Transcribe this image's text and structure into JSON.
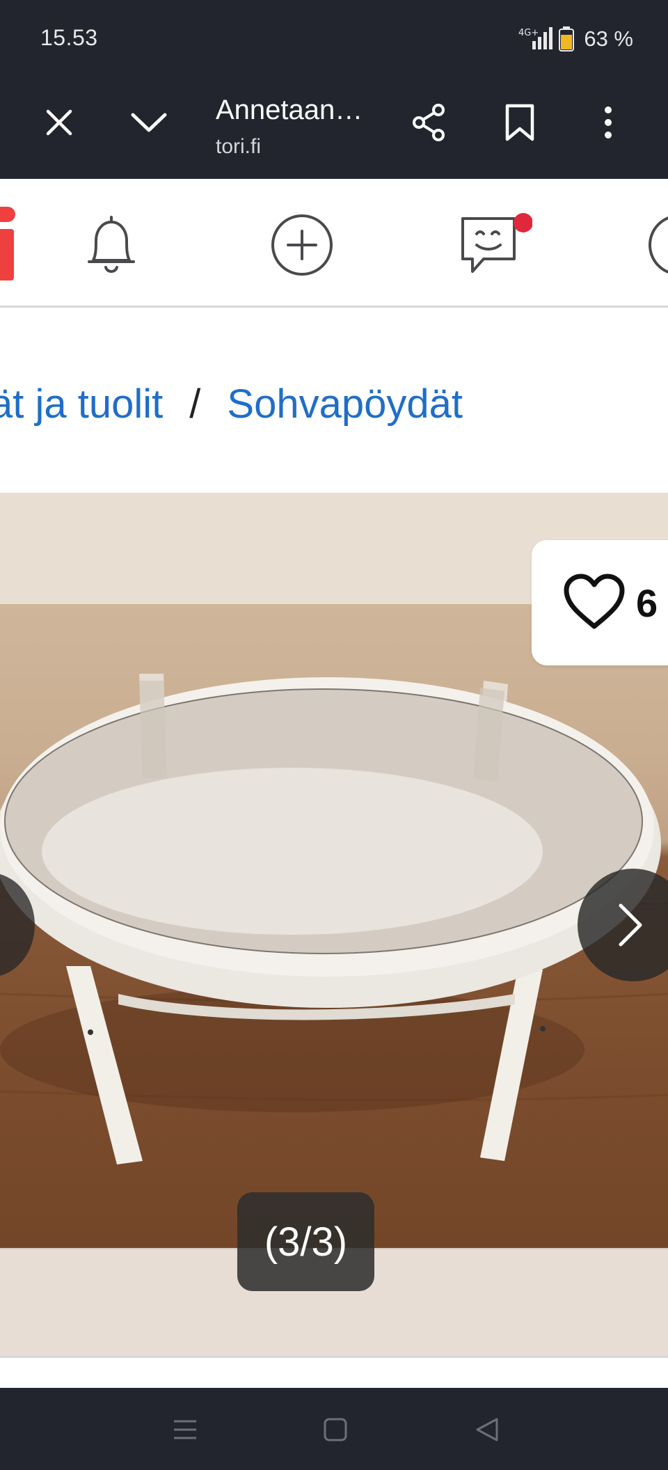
{
  "status_bar": {
    "time": "15.53",
    "network": "4G+",
    "battery": "63 %",
    "icons": [
      "network-4g-icon",
      "signal-icon",
      "battery-icon"
    ]
  },
  "browser": {
    "title": "Annetaan…",
    "domain": "tori.fi",
    "icons": [
      "close-icon",
      "chevron-down-icon",
      "share-icon",
      "bookmark-icon",
      "more-vert-icon"
    ]
  },
  "site_header": {
    "icons": [
      "tori-logo",
      "bell-icon",
      "add-circle-icon",
      "messages-icon",
      "profile-icon"
    ],
    "messages_has_notification": true
  },
  "breadcrumb": {
    "items": [
      "ät ja tuolit",
      "Sohvapöydät"
    ],
    "separator": "/"
  },
  "gallery": {
    "favorite_count": "6",
    "counter": "(3/3)",
    "icons": [
      "heart-icon",
      "chevron-left-icon",
      "chevron-right-icon"
    ]
  },
  "android_nav": {
    "icons": [
      "recents-icon",
      "home-icon",
      "back-icon"
    ]
  },
  "colors": {
    "chrome": "#22252d",
    "link": "#1f6ec8",
    "brand": "#ef4040",
    "notification": "#e0283c"
  }
}
